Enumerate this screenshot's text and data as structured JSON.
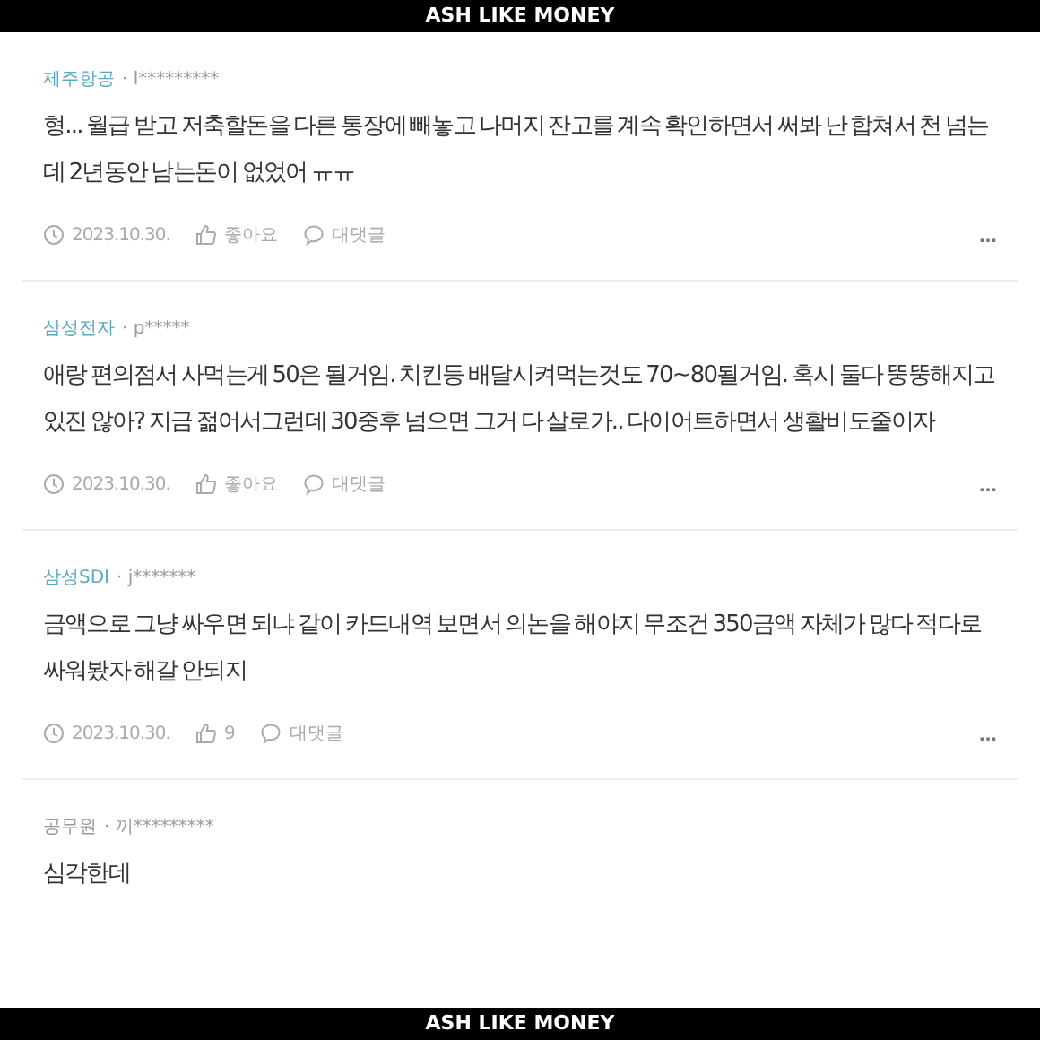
{
  "header": {
    "title": "ASH LIKE MONEY"
  },
  "comments": [
    {
      "company": "제주항공",
      "color": "#5aa9c2",
      "user": "· l*********",
      "text": "형... 월급 받고 저축할돈을 다른 통장에 빼놓고 나머지 잔고를 계속 확인하면서 써봐 난 합쳐서 천 넘는데 2년동안 남는돈이 없었어 ㅠㅠ",
      "date": "2023.10.30.",
      "likes": "좋아요",
      "reply": "대댓글",
      "more": "..."
    },
    {
      "company": "삼성전자",
      "color": "#5aa9c2",
      "user": "· p*****",
      "text": "애랑 편의점서 사먹는게 50은 될거임. 치킨등 배달시켜먹는것도 70~80될거임. 혹시 둘다 뚱뚱해지고있진 않아? 지금 젊어서그런데 30중후 넘으면 그거 다 살로가.. 다이어트하면서 생활비도줄이자",
      "date": "2023.10.30.",
      "likes": "좋아요",
      "reply": "대댓글",
      "more": "..."
    },
    {
      "company": "삼성SDI",
      "color": "#5aa9c2",
      "user": "· j*******",
      "text": "금액으로 그냥 싸우면 되냐 같이 카드내역 보면서 의논을 해야지 무조건 350금액 자체가 많다 적다로 싸워봤자 해갈 안되지",
      "date": "2023.10.30.",
      "likes": "9",
      "reply": "대댓글",
      "more": "..."
    },
    {
      "company": "공무원",
      "color": "#999999",
      "user": "· 끼*********",
      "text": "심각한데"
    }
  ],
  "footer": {
    "title": "ASH LIKE MONEY"
  }
}
